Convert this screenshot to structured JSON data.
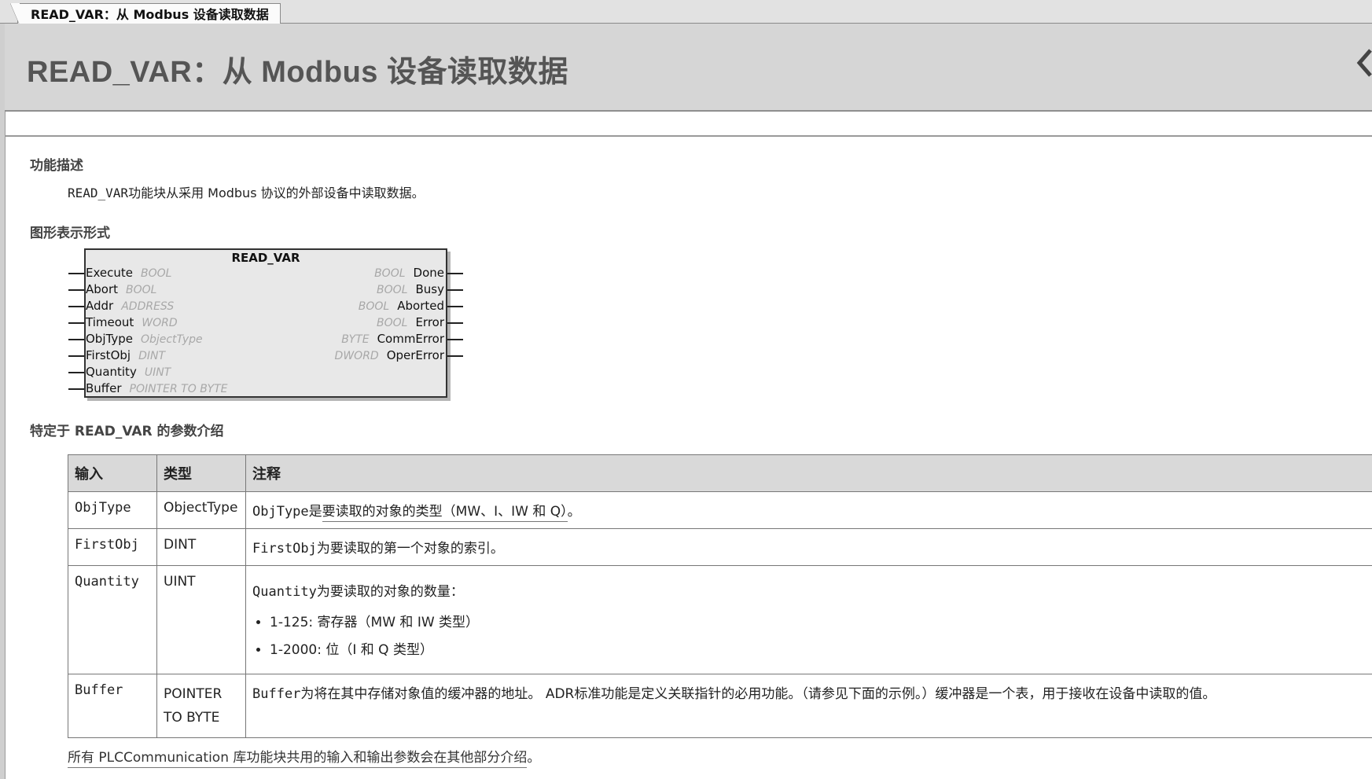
{
  "tab": {
    "label": "READ_VAR：从 Modbus 设备读取数据"
  },
  "header": {
    "title": "READ_VAR：从 Modbus 设备读取数据"
  },
  "description": {
    "heading": "功能描述",
    "text_code": "READ_VAR",
    "text_rest": "功能块从采用 Modbus 协议的外部设备中读取数据。"
  },
  "graphic": {
    "heading": "图形表示形式",
    "block_name": "READ_VAR",
    "inputs": [
      {
        "name": "Execute",
        "type": "BOOL"
      },
      {
        "name": "Abort",
        "type": "BOOL"
      },
      {
        "name": "Addr",
        "type": "ADDRESS"
      },
      {
        "name": "Timeout",
        "type": "WORD"
      },
      {
        "name": "ObjType",
        "type": "ObjectType"
      },
      {
        "name": "FirstObj",
        "type": "DINT"
      },
      {
        "name": "Quantity",
        "type": "UINT"
      },
      {
        "name": "Buffer",
        "type": "POINTER TO BYTE"
      }
    ],
    "outputs": [
      {
        "name": "Done",
        "type": "BOOL"
      },
      {
        "name": "Busy",
        "type": "BOOL"
      },
      {
        "name": "Aborted",
        "type": "BOOL"
      },
      {
        "name": "Error",
        "type": "BOOL"
      },
      {
        "name": "CommError",
        "type": "BYTE"
      },
      {
        "name": "OperError",
        "type": "DWORD"
      }
    ]
  },
  "params": {
    "heading": "特定于 READ_VAR 的参数介绍",
    "headers": [
      "输入",
      "类型",
      "注释"
    ],
    "rows": [
      {
        "input": "ObjType",
        "type": "ObjectType",
        "note_code": "ObjType",
        "note_pre": "是",
        "note_link": "要读取的对象的类型（MW、I、IW 和 Q）",
        "note_post": "。"
      },
      {
        "input": "FirstObj",
        "type": "DINT",
        "note_code": "FirstObj",
        "note_text": "为要读取的第一个对象的索引。"
      },
      {
        "input": "Quantity",
        "type": "UINT",
        "note_code": "Quantity",
        "note_text": "为要读取的对象的数量：",
        "bullets": [
          "1-125: 寄存器（MW 和 IW 类型）",
          "1-2000: 位（I 和 Q 类型）"
        ]
      },
      {
        "input": "Buffer",
        "type": "POINTER TO BYTE",
        "note_code": "Buffer",
        "note_text": "为将在其中存储对象值的缓冲器的地址。 ADR标准功能是定义关联指针的必用功能。（请参见下面的示例。）缓冲器是一个表，用于接收在设备中读取的值。"
      }
    ]
  },
  "footer": {
    "text": "所有 PLCCommunication 库功能块共用的输入和输出参数会在其他部分介绍",
    "suffix": "。"
  }
}
